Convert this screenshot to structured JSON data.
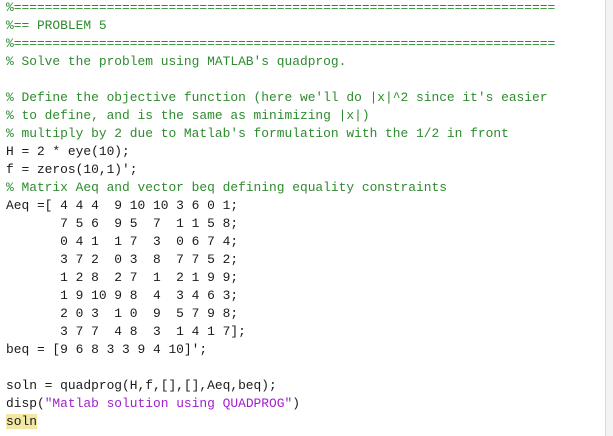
{
  "colors": {
    "comment": "#2e8b2e",
    "string": "#a020d0",
    "code": "#1a1a1a",
    "highlight": "#f2e7a3",
    "background": "#ffffff"
  },
  "code_lines": [
    {
      "type": "comment",
      "text": "%======================================================================"
    },
    {
      "type": "comment",
      "text": "%== PROBLEM 5"
    },
    {
      "type": "comment",
      "text": "%======================================================================"
    },
    {
      "type": "comment",
      "text": "% Solve the problem using MATLAB's quadprog."
    },
    {
      "type": "blank",
      "text": ""
    },
    {
      "type": "comment",
      "text": "% Define the objective function (here we'll do |x|^2 since it's easier"
    },
    {
      "type": "comment",
      "text": "% to define, and is the same as minimizing |x|)"
    },
    {
      "type": "comment",
      "text": "% multiply by 2 due to Matlab's formulation with the 1/2 in front"
    },
    {
      "type": "code",
      "text": "H = 2 * eye(10);"
    },
    {
      "type": "code",
      "text": "f = zeros(10,1)';"
    },
    {
      "type": "comment",
      "text": "% Matrix Aeq and vector beq defining equality constraints"
    },
    {
      "type": "code",
      "text": "Aeq =[ 4 4 4  9 10 10 3 6 0 1;"
    },
    {
      "type": "code",
      "text": "       7 5 6  9 5  7  1 1 5 8;"
    },
    {
      "type": "code",
      "text": "       0 4 1  1 7  3  0 6 7 4;"
    },
    {
      "type": "code",
      "text": "       3 7 2  0 3  8  7 7 5 2;"
    },
    {
      "type": "code",
      "text": "       1 2 8  2 7  1  2 1 9 9;"
    },
    {
      "type": "code",
      "text": "       1 9 10 9 8  4  3 4 6 3;"
    },
    {
      "type": "code",
      "text": "       2 0 3  1 0  9  5 7 9 8;"
    },
    {
      "type": "code",
      "text": "       3 7 7  4 8  3  1 4 1 7];"
    },
    {
      "type": "code",
      "text": "beq = [9 6 8 3 3 9 4 10]';"
    },
    {
      "type": "blank",
      "text": ""
    },
    {
      "type": "code",
      "text": "soln = quadprog(H,f,[],[],Aeq,beq);"
    },
    {
      "type": "mixed",
      "before": "disp(",
      "string": "\"Matlab solution using QUADPROG\"",
      "after": ")"
    },
    {
      "type": "highlight",
      "text": "soln"
    }
  ]
}
